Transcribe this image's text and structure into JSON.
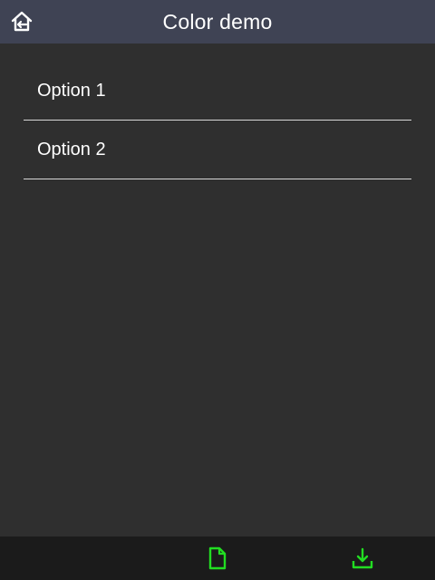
{
  "header": {
    "title": "Color demo",
    "back_icon": "home-back-icon"
  },
  "list": {
    "items": [
      {
        "label": "Option 1"
      },
      {
        "label": "Option 2"
      }
    ]
  },
  "footer": {
    "icons": [
      "file-icon",
      "download-icon"
    ],
    "accent_color": "#22dd22"
  },
  "colors": {
    "header_bg": "#3f4354",
    "body_bg": "#2f2f2f",
    "footer_bg": "#1b1b1b",
    "divider": "#d7d7d7"
  }
}
